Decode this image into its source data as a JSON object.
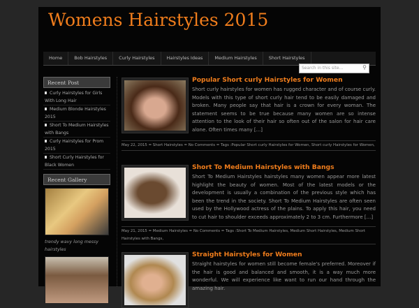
{
  "site_title": "Womens Hairstyles 2015",
  "nav": [
    "Home",
    "Bob Hairstyles",
    "Curly Hairstyles",
    "Hairstyles Ideas",
    "Medium Hairstyles",
    "Short Hairstyles"
  ],
  "search_placeholder": "Search in this site...",
  "sidebar": {
    "recent_post_title": "Recent Post",
    "recent_posts": [
      "Curly Hairstyles for Girls With Long Hair",
      "Medium Blonde Hairstyles 2015",
      "Short To Medium Hairstyles with Bangs",
      "Curly Hairstyles for Prom 2015",
      "Short Curly Hairstyles for Black Women"
    ],
    "gallery_title": "Recent Gallery",
    "gallery_caption": "trendy wavy long messy hairstyles"
  },
  "posts": [
    {
      "title": "Popular Short curly Hairstyles for Women",
      "text": "Short curly hairstyles for women has rugged character and of course curly. Models with this type of short curly hair tend to be easily damaged and broken. Many people say that hair is a crown for every woman. The statement seems to be true because many women are so intense attention to the look of their hair so often out of the salon for hair care alone. Often times many [...]",
      "meta": "May 22, 2015  =  Short Hairstyles  =  No Comments  =  Tags :Popular Short curly Hairstyles for Women, Short curly Hairstyles for Women,"
    },
    {
      "title": "Short To Medium Hairstyles with Bangs",
      "text": "Short To Medium Hairstyles hairstyles many women appear more latest highlight the beauty of women. Most of the latest models or the development is usually a combination of the previous style which has been the trend in the society. Short To Medium Hairstyles are often seen used by the Hollywood actress of the plains. To apply this hair, you need to cut hair to shoulder exceeds approximately 2 to 3 cm. Furthermore [...]",
      "meta": "May 21, 2015  =  Medium Hairstyles  =  No Comments  =  Tags :Short To Medium Hairstyles, Medium Short Hairstyles, Medium Short Hairstyles with Bangs,"
    },
    {
      "title": "Straight Hairstyles for Women",
      "text": "Straight hairstyles for women still become female's preferred. Moreover if the hair is good and balanced and smooth, it is a way much more wonderful. We will experience like want to run our hand through the amazing hair."
    }
  ]
}
